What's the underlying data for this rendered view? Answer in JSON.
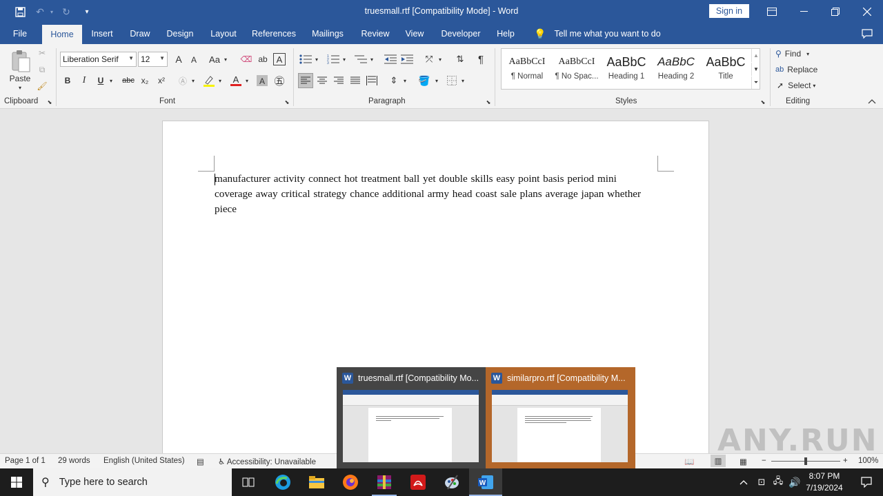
{
  "window": {
    "title": "truesmall.rtf [Compatibility Mode]  -  Word",
    "sign_in": "Sign in"
  },
  "tabs": [
    "File",
    "Home",
    "Insert",
    "Draw",
    "Design",
    "Layout",
    "References",
    "Mailings",
    "Review",
    "View",
    "Developer",
    "Help"
  ],
  "active_tab": "Home",
  "tell_me": "Tell me what you want to do",
  "clipboard": {
    "paste": "Paste",
    "label": "Clipboard"
  },
  "font": {
    "family": "Liberation Serif",
    "size": "12",
    "label": "Font",
    "grow": "A",
    "shrink": "A",
    "case": "Aa",
    "bold": "B",
    "italic": "I",
    "underline": "U",
    "strike": "abc",
    "subscript": "x₂",
    "superscript": "x²"
  },
  "paragraph": {
    "label": "Paragraph"
  },
  "styles": {
    "label": "Styles",
    "items": [
      {
        "sample": "AaBbCcI",
        "name": "¶ Normal"
      },
      {
        "sample": "AaBbCcI",
        "name": "¶ No Spac..."
      },
      {
        "sample": "AaBbC",
        "name": "Heading 1"
      },
      {
        "sample": "AaBbC",
        "name": "Heading 2"
      },
      {
        "sample": "AaBbC",
        "name": "Title"
      }
    ]
  },
  "editing": {
    "label": "Editing",
    "find": "Find",
    "replace": "Replace",
    "select": "Select"
  },
  "document": {
    "text": "manufacturer activity    connect    hot treatment ball yet double skills  easy point basis period mini coverage away critical strategy chance additional army head coast sale    plans    average japan whether    piece"
  },
  "status": {
    "page": "Page 1 of 1",
    "words": "29 words",
    "language": "English (United States)",
    "accessibility": "Accessibility: Unavailable",
    "zoom": "100%",
    "zoom_minus": "−",
    "zoom_plus": "+"
  },
  "taskbar_thumbs": [
    {
      "title": "truesmall.rtf [Compatibility Mo..."
    },
    {
      "title": "similarpro.rtf [Compatibility M..."
    }
  ],
  "watermark": "ANY.RUN",
  "taskbar": {
    "search_placeholder": "Type here to search",
    "time": "8:07 PM",
    "date": "7/19/2024"
  },
  "colors": {
    "word_blue": "#2b579a",
    "ribbon_bg": "#f3f3f3",
    "thumb_active": "#b4672a",
    "taskbar": "#1d1d1d"
  }
}
